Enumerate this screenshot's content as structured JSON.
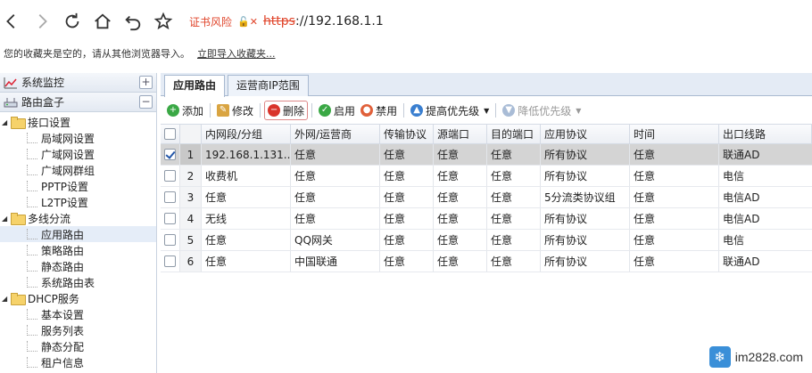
{
  "browser": {
    "security_warning": "证书风险",
    "url_protocol": "https",
    "url_host": "://192.168.1.1"
  },
  "bookmarks_bar": {
    "empty_message": "您的收藏夹是空的，请从其他浏览器导入。",
    "import_link": "立即导入收藏夹..."
  },
  "sidebar": {
    "panels": [
      {
        "label": "系统监控",
        "toggle": "+"
      },
      {
        "label": "路由盒子",
        "toggle": "−"
      }
    ],
    "tree": [
      {
        "label": "接口设置",
        "level": 1
      },
      {
        "label": "局域网设置",
        "level": 2
      },
      {
        "label": "广域网设置",
        "level": 2
      },
      {
        "label": "广域网群组",
        "level": 2
      },
      {
        "label": "PPTP设置",
        "level": 2
      },
      {
        "label": "L2TP设置",
        "level": 2
      },
      {
        "label": "多线分流",
        "level": 1
      },
      {
        "label": "应用路由",
        "level": 2,
        "selected": true
      },
      {
        "label": "策略路由",
        "level": 2
      },
      {
        "label": "静态路由",
        "level": 2
      },
      {
        "label": "系统路由表",
        "level": 2
      },
      {
        "label": "DHCP服务",
        "level": 1
      },
      {
        "label": "基本设置",
        "level": 2
      },
      {
        "label": "服务列表",
        "level": 2
      },
      {
        "label": "静态分配",
        "level": 2
      },
      {
        "label": "租户信息",
        "level": 2
      }
    ]
  },
  "tabs": [
    {
      "label": "应用路由",
      "active": true
    },
    {
      "label": "运营商IP范围",
      "active": false
    }
  ],
  "toolbar": {
    "add": "添加",
    "edit": "修改",
    "delete": "删除",
    "enable": "启用",
    "disable": "禁用",
    "raise_priority": "提高优先级",
    "lower_priority": "降低优先级"
  },
  "table": {
    "columns": [
      "内网段/分组",
      "外网/运营商",
      "传输协议",
      "源端口",
      "目的端口",
      "应用协议",
      "时间",
      "出口线路"
    ],
    "rows": [
      {
        "num": "1",
        "checked": true,
        "cells": [
          "192.168.1.131...",
          "任意",
          "任意",
          "任意",
          "任意",
          "所有协议",
          "任意",
          "联通AD"
        ]
      },
      {
        "num": "2",
        "checked": false,
        "cells": [
          "收费机",
          "任意",
          "任意",
          "任意",
          "任意",
          "所有协议",
          "任意",
          "电信"
        ]
      },
      {
        "num": "3",
        "checked": false,
        "cells": [
          "任意",
          "任意",
          "任意",
          "任意",
          "任意",
          "5分流类协议组",
          "任意",
          "电信AD"
        ]
      },
      {
        "num": "4",
        "checked": false,
        "cells": [
          "无线",
          "任意",
          "任意",
          "任意",
          "任意",
          "所有协议",
          "任意",
          "电信AD"
        ]
      },
      {
        "num": "5",
        "checked": false,
        "cells": [
          "任意",
          "QQ网关",
          "任意",
          "任意",
          "任意",
          "所有协议",
          "任意",
          "电信"
        ]
      },
      {
        "num": "6",
        "checked": false,
        "cells": [
          "任意",
          "中国联通",
          "任意",
          "任意",
          "任意",
          "所有协议",
          "任意",
          "联通AD"
        ]
      }
    ]
  },
  "watermark": {
    "text": "im2828.com"
  },
  "colors": {
    "warning_red": "#e0452b",
    "selected_row": "#d4d4d4",
    "tab_bar": "#e4ebf5"
  }
}
